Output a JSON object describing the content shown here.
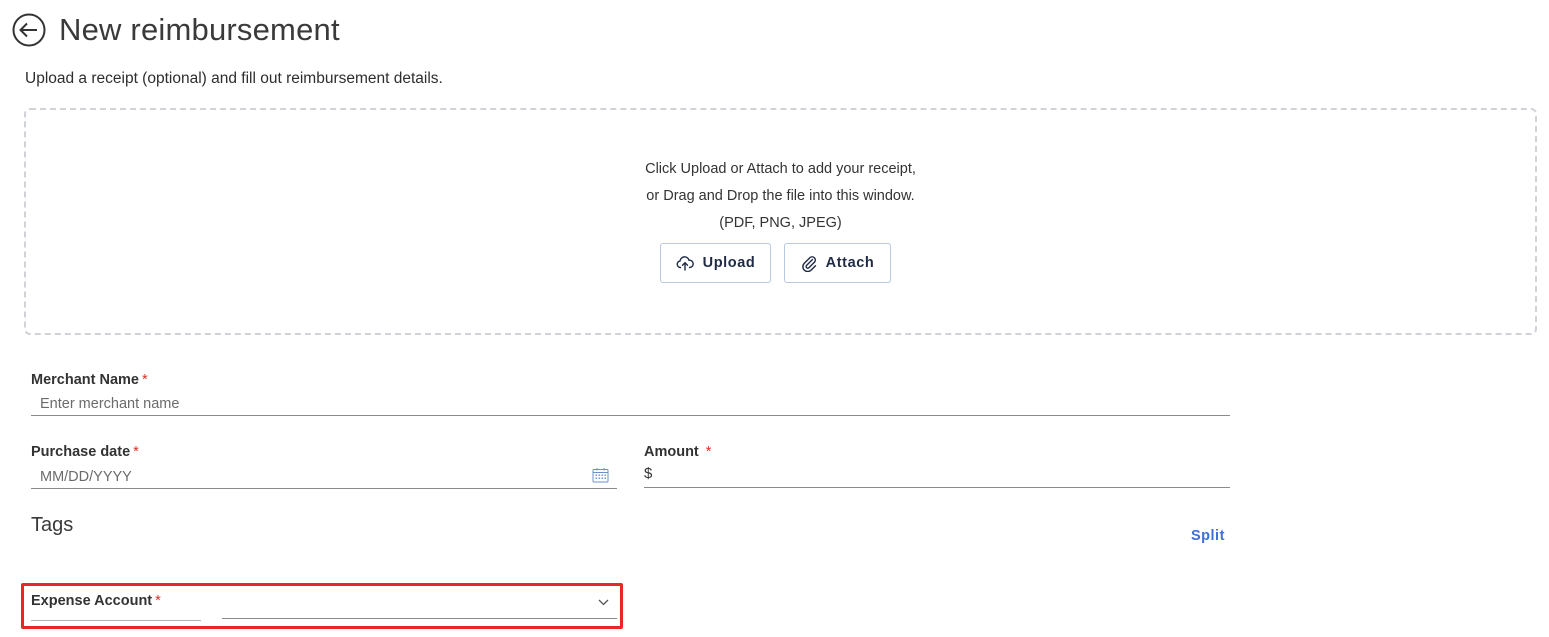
{
  "header": {
    "title": "New reimbursement",
    "subtitle": "Upload a receipt (optional) and fill out reimbursement details."
  },
  "dropzone": {
    "line1": "Click Upload or Attach to add your receipt,",
    "line2": "or Drag and Drop the file into this window.",
    "line3": "(PDF, PNG, JPEG)",
    "upload_label": "Upload",
    "attach_label": "Attach"
  },
  "form": {
    "merchant": {
      "label": "Merchant Name",
      "required": "*",
      "placeholder": "Enter merchant name",
      "value": ""
    },
    "purchase_date": {
      "label": "Purchase date",
      "required": "*",
      "placeholder": "MM/DD/YYYY",
      "value": ""
    },
    "amount": {
      "label": "Amount",
      "required": "*",
      "currency": "$",
      "value": ""
    },
    "tags_heading": "Tags",
    "split_label": "Split",
    "expense_account": {
      "label": "Expense Account",
      "required": "*",
      "selected": ""
    }
  },
  "icons": {
    "back": "arrow-left-circle-icon",
    "upload": "cloud-upload-icon",
    "attach": "paperclip-icon",
    "calendar": "calendar-icon",
    "dropdown": "chevron-down-icon"
  },
  "colors": {
    "accent": "#3f6fd8",
    "required": "#d93025",
    "highlight": "#e8262b",
    "button_border": "#b9c7e0"
  }
}
